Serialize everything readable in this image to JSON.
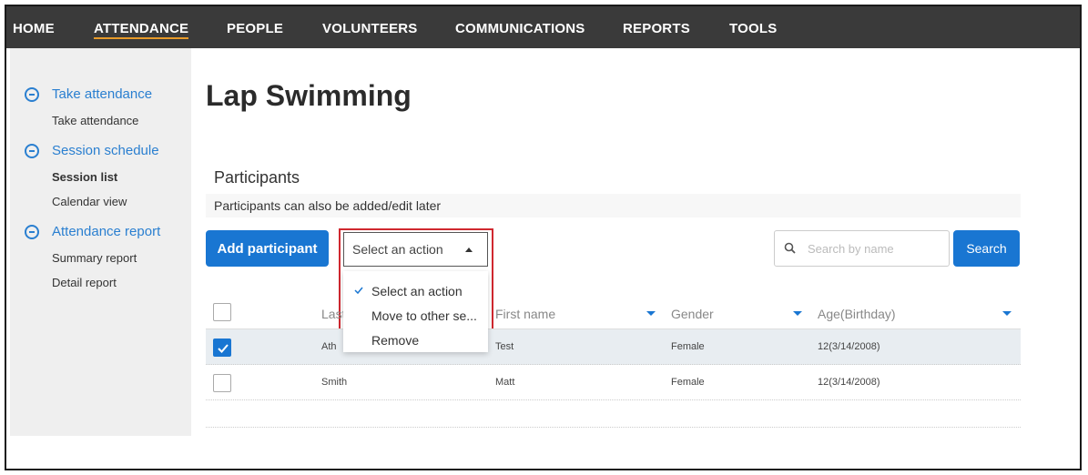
{
  "nav": {
    "items": [
      {
        "label": "HOME",
        "active": false
      },
      {
        "label": "ATTENDANCE",
        "active": true
      },
      {
        "label": "PEOPLE",
        "active": false
      },
      {
        "label": "VOLUNTEERS",
        "active": false
      },
      {
        "label": "COMMUNICATIONS",
        "active": false
      },
      {
        "label": "REPORTS",
        "active": false
      },
      {
        "label": "TOOLS",
        "active": false
      }
    ],
    "active_color": "#e89b2a"
  },
  "sidebar": {
    "groups": [
      {
        "title": "Take attendance",
        "icon": "minus-circle-icon",
        "links": [
          {
            "label": "Take attendance",
            "bold": false
          }
        ]
      },
      {
        "title": "Session schedule",
        "icon": "minus-circle-icon",
        "links": [
          {
            "label": "Session list",
            "bold": true
          },
          {
            "label": "Calendar view",
            "bold": false
          }
        ]
      },
      {
        "title": "Attendance report",
        "icon": "minus-circle-icon",
        "links": [
          {
            "label": "Summary report",
            "bold": false
          },
          {
            "label": "Detail report",
            "bold": false
          }
        ]
      }
    ]
  },
  "page": {
    "title": "Lap Swimming",
    "section_title": "Participants",
    "note": "Participants can also be added/edit later"
  },
  "toolbar": {
    "add_label": "Add participant",
    "select_value": "Select an action",
    "options": [
      "Select an action",
      "Move to other se...",
      "Remove"
    ],
    "selected_option": "Select an action",
    "search_placeholder": "Search by name",
    "search_label": "Search"
  },
  "table": {
    "columns": [
      "Last",
      "First name",
      "Gender",
      "Age(Birthday)"
    ],
    "rows": [
      {
        "last": "Ath",
        "first": "Test",
        "gender": "Female",
        "age": "12(3/14/2008)",
        "checked": true
      },
      {
        "last": "Smith",
        "first": "Matt",
        "gender": "Female",
        "age": "12(3/14/2008)",
        "checked": false
      }
    ]
  },
  "colors": {
    "primary": "#1976d2",
    "highlight": "#d0282f",
    "nav_bg": "#3a3a3a",
    "sidebar_bg": "#efefef"
  }
}
